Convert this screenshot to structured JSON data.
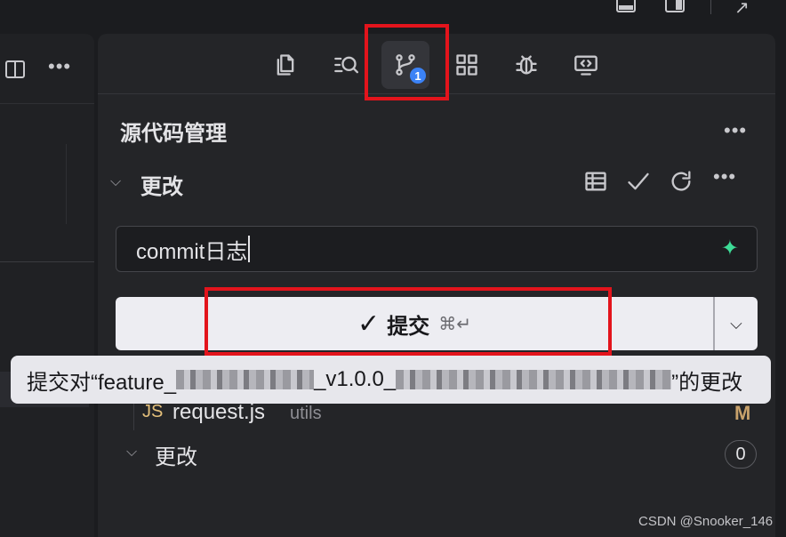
{
  "scm": {
    "title": "源代码管理",
    "changes_label": "更改",
    "staged_label": "更改",
    "staged_count": "0"
  },
  "activity": {
    "badge": "1"
  },
  "commit": {
    "message": "commit日志",
    "button_label": "提交",
    "shortcut": "⌘↵",
    "dropdown_icon": "chevron-down-icon"
  },
  "tooltip": {
    "prefix": "提交对“feature_",
    "middle": "_v1.0.0_",
    "suffix": "”的更改"
  },
  "file": {
    "type": "JS",
    "name": "request.js",
    "path": "utils",
    "status": "M"
  },
  "watermark": "CSDN @Snooker_146",
  "colors": {
    "highlight_box": "#e3141c",
    "badge": "#3b82f6",
    "sparkle": "#3ddc97",
    "modified": "#c9a26b"
  }
}
